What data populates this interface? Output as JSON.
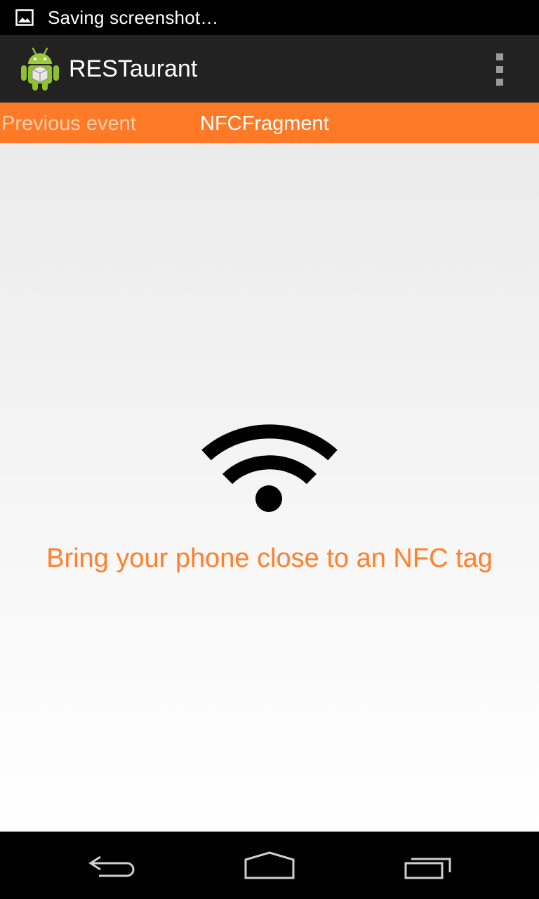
{
  "status_bar": {
    "notification_text": "Saving screenshot…",
    "notification_icon": "image-icon"
  },
  "action_bar": {
    "app_icon": "android-robot-icon",
    "title": "RESTaurant",
    "overflow_icon": "overflow-menu-icon"
  },
  "tabs": {
    "previous_label": "Previous event",
    "current_label": "NFCFragment"
  },
  "content": {
    "nfc_icon": "nfc-signal-icon",
    "prompt": "Bring your phone close to an NFC tag"
  },
  "nav_bar": {
    "back_icon": "back-icon",
    "home_icon": "home-icon",
    "recents_icon": "recents-icon"
  },
  "colors": {
    "accent": "#ff7a26",
    "prompt_text": "#ff7f2a",
    "action_bar": "#222222"
  }
}
